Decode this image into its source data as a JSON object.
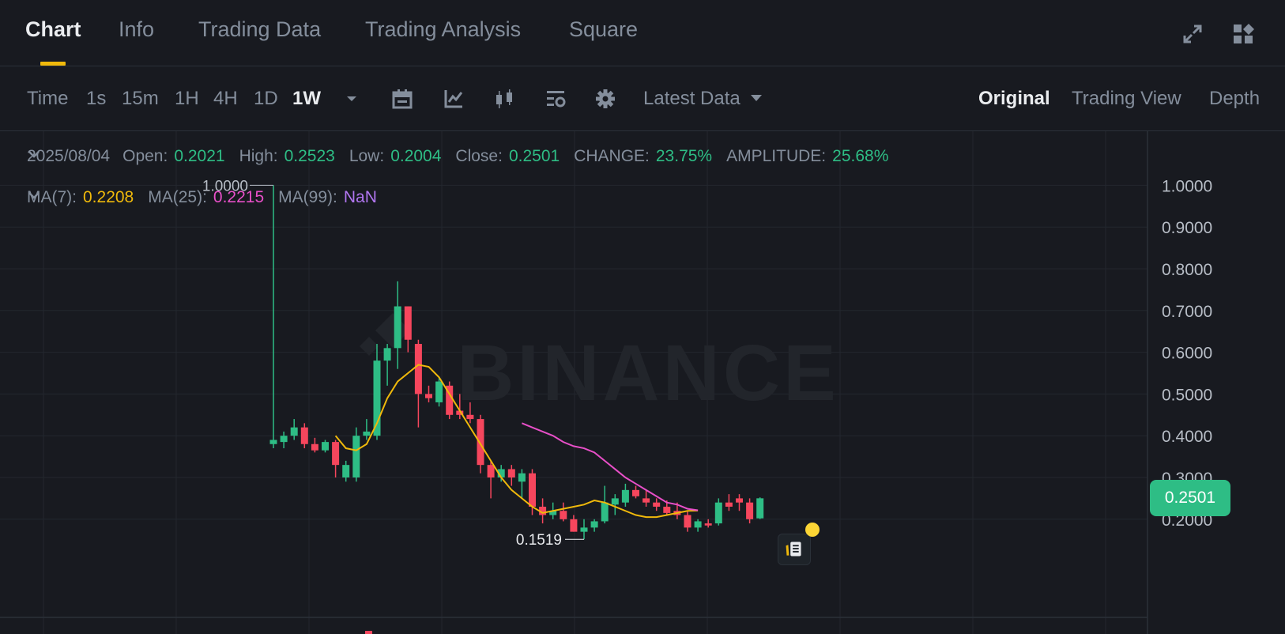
{
  "tabs": [
    {
      "label": "Chart",
      "active": true
    },
    {
      "label": "Info"
    },
    {
      "label": "Trading Data"
    },
    {
      "label": "Trading Analysis"
    },
    {
      "label": "Square"
    }
  ],
  "header_icons": [
    "fullscreen-icon",
    "widgets-icon"
  ],
  "toolbar": {
    "time_label": "Time",
    "timeframes": [
      "1s",
      "15m",
      "1H",
      "4H",
      "1D",
      "1W"
    ],
    "active_timeframe": "1W",
    "tool_icons": [
      "calendar-icon",
      "indicator-icon",
      "candle-type-icon",
      "layout-icon",
      "settings-icon"
    ],
    "latest_data": "Latest Data",
    "views": [
      "Original",
      "Trading View",
      "Depth"
    ],
    "active_view": "Original"
  },
  "legend": {
    "date": "2025/08/04",
    "open_label": "Open:",
    "open": "0.2021",
    "high_label": "High:",
    "high": "0.2523",
    "low_label": "Low:",
    "low": "0.2004",
    "close_label": "Close:",
    "close": "0.2501",
    "change_label": "CHANGE:",
    "change": "23.75%",
    "amplitude_label": "AMPLITUDE:",
    "amplitude": "25.68%",
    "ma7_label": "MA(7):",
    "ma7": "0.2208",
    "ma25_label": "MA(25):",
    "ma25": "0.2215",
    "ma99_label": "MA(99):",
    "ma99": "NaN"
  },
  "current_price": "0.2501",
  "colors": {
    "up": "#2ebd85",
    "down": "#f6465d",
    "ma7": "#f0b90b",
    "ma25": "#e84fc8",
    "accent": "#f0b90b",
    "background": "#181a20"
  },
  "chart_data": {
    "type": "candlestick",
    "watermark": "BINANCE",
    "y_ticks": [
      "1.0000",
      "0.9000",
      "0.8000",
      "0.7000",
      "0.6000",
      "0.5000",
      "0.4000",
      "0.3000",
      "0.2000"
    ],
    "ylim": [
      0.05,
      1.05
    ],
    "annotations": {
      "max": "1.0000",
      "min": "0.1519"
    },
    "candles": [
      {
        "o": 0.38,
        "h": 1.0,
        "l": 0.37,
        "c": 0.39
      },
      {
        "o": 0.385,
        "h": 0.41,
        "l": 0.37,
        "c": 0.4
      },
      {
        "o": 0.4,
        "h": 0.44,
        "l": 0.39,
        "c": 0.42
      },
      {
        "o": 0.42,
        "h": 0.43,
        "l": 0.37,
        "c": 0.38
      },
      {
        "o": 0.38,
        "h": 0.395,
        "l": 0.36,
        "c": 0.365
      },
      {
        "o": 0.365,
        "h": 0.39,
        "l": 0.36,
        "c": 0.385
      },
      {
        "o": 0.385,
        "h": 0.39,
        "l": 0.3,
        "c": 0.33
      },
      {
        "o": 0.3,
        "h": 0.34,
        "l": 0.29,
        "c": 0.33
      },
      {
        "o": 0.3,
        "h": 0.42,
        "l": 0.29,
        "c": 0.4
      },
      {
        "o": 0.4,
        "h": 0.44,
        "l": 0.39,
        "c": 0.41
      },
      {
        "o": 0.4,
        "h": 0.62,
        "l": 0.39,
        "c": 0.58
      },
      {
        "o": 0.58,
        "h": 0.62,
        "l": 0.52,
        "c": 0.61
      },
      {
        "o": 0.61,
        "h": 0.77,
        "l": 0.56,
        "c": 0.71
      },
      {
        "o": 0.71,
        "h": 0.71,
        "l": 0.6,
        "c": 0.63
      },
      {
        "o": 0.62,
        "h": 0.63,
        "l": 0.42,
        "c": 0.5
      },
      {
        "o": 0.5,
        "h": 0.52,
        "l": 0.48,
        "c": 0.49
      },
      {
        "o": 0.48,
        "h": 0.54,
        "l": 0.47,
        "c": 0.53
      },
      {
        "o": 0.52,
        "h": 0.53,
        "l": 0.44,
        "c": 0.45
      },
      {
        "o": 0.46,
        "h": 0.5,
        "l": 0.44,
        "c": 0.45
      },
      {
        "o": 0.45,
        "h": 0.48,
        "l": 0.43,
        "c": 0.44
      },
      {
        "o": 0.44,
        "h": 0.45,
        "l": 0.31,
        "c": 0.33
      },
      {
        "o": 0.33,
        "h": 0.34,
        "l": 0.25,
        "c": 0.3
      },
      {
        "o": 0.3,
        "h": 0.33,
        "l": 0.29,
        "c": 0.32
      },
      {
        "o": 0.32,
        "h": 0.33,
        "l": 0.28,
        "c": 0.3
      },
      {
        "o": 0.29,
        "h": 0.32,
        "l": 0.25,
        "c": 0.31
      },
      {
        "o": 0.31,
        "h": 0.32,
        "l": 0.21,
        "c": 0.23
      },
      {
        "o": 0.23,
        "h": 0.25,
        "l": 0.19,
        "c": 0.21
      },
      {
        "o": 0.21,
        "h": 0.24,
        "l": 0.2,
        "c": 0.22
      },
      {
        "o": 0.22,
        "h": 0.24,
        "l": 0.195,
        "c": 0.2
      },
      {
        "o": 0.2,
        "h": 0.21,
        "l": 0.17,
        "c": 0.17
      },
      {
        "o": 0.17,
        "h": 0.2,
        "l": 0.1519,
        "c": 0.18
      },
      {
        "o": 0.18,
        "h": 0.2,
        "l": 0.17,
        "c": 0.195
      },
      {
        "o": 0.195,
        "h": 0.28,
        "l": 0.19,
        "c": 0.24
      },
      {
        "o": 0.235,
        "h": 0.26,
        "l": 0.21,
        "c": 0.25
      },
      {
        "o": 0.24,
        "h": 0.285,
        "l": 0.23,
        "c": 0.27
      },
      {
        "o": 0.27,
        "h": 0.28,
        "l": 0.25,
        "c": 0.255
      },
      {
        "o": 0.25,
        "h": 0.27,
        "l": 0.23,
        "c": 0.24
      },
      {
        "o": 0.24,
        "h": 0.25,
        "l": 0.22,
        "c": 0.23
      },
      {
        "o": 0.23,
        "h": 0.245,
        "l": 0.21,
        "c": 0.215
      },
      {
        "o": 0.22,
        "h": 0.24,
        "l": 0.2,
        "c": 0.21
      },
      {
        "o": 0.21,
        "h": 0.22,
        "l": 0.17,
        "c": 0.18
      },
      {
        "o": 0.18,
        "h": 0.2,
        "l": 0.17,
        "c": 0.195
      },
      {
        "o": 0.19,
        "h": 0.2,
        "l": 0.18,
        "c": 0.185
      },
      {
        "o": 0.19,
        "h": 0.25,
        "l": 0.185,
        "c": 0.24
      },
      {
        "o": 0.24,
        "h": 0.26,
        "l": 0.22,
        "c": 0.23
      },
      {
        "o": 0.25,
        "h": 0.26,
        "l": 0.22,
        "c": 0.24
      },
      {
        "o": 0.24,
        "h": 0.25,
        "l": 0.19,
        "c": 0.2
      },
      {
        "o": 0.2021,
        "h": 0.2523,
        "l": 0.2004,
        "c": 0.2501
      }
    ],
    "ma7": [
      0.4,
      0.37,
      0.365,
      0.38,
      0.43,
      0.49,
      0.53,
      0.55,
      0.57,
      0.565,
      0.54,
      0.5,
      0.46,
      0.42,
      0.38,
      0.34,
      0.3,
      0.27,
      0.25,
      0.23,
      0.215,
      0.22,
      0.225,
      0.23,
      0.235,
      0.245,
      0.24,
      0.23,
      0.22,
      0.21,
      0.205,
      0.205,
      0.21,
      0.215,
      0.22,
      0.2208
    ],
    "ma25": [
      0.43,
      0.42,
      0.41,
      0.4,
      0.385,
      0.375,
      0.37,
      0.36,
      0.34,
      0.32,
      0.3,
      0.285,
      0.27,
      0.255,
      0.24,
      0.235,
      0.225,
      0.2215
    ]
  }
}
